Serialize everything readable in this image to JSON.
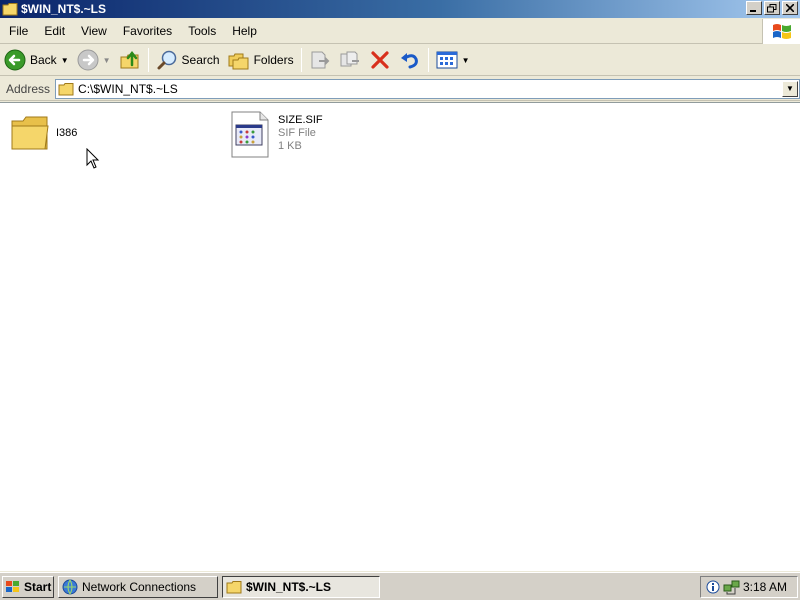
{
  "window": {
    "title": "$WIN_NT$.~LS"
  },
  "menu": [
    "File",
    "Edit",
    "View",
    "Favorites",
    "Tools",
    "Help"
  ],
  "toolbar": {
    "back_label": "Back",
    "search_label": "Search",
    "folders_label": "Folders"
  },
  "address": {
    "label": "Address",
    "value": "C:\\$WIN_NT$.~LS"
  },
  "files": [
    {
      "name": "I386",
      "type": "folder"
    },
    {
      "name": "SIZE.SIF",
      "kind": "SIF File",
      "size": "1 KB",
      "type": "file"
    }
  ],
  "taskbar": {
    "start_label": "Start",
    "tasks": [
      {
        "label": "Network Connections",
        "active": false
      },
      {
        "label": "$WIN_NT$.~LS",
        "active": true
      }
    ],
    "clock": "3:18 AM"
  },
  "colors": {
    "title_gradient_start": "#0a246a",
    "title_gradient_end": "#a6caf0",
    "face": "#ece9d8",
    "folder": "#f5d66a"
  }
}
